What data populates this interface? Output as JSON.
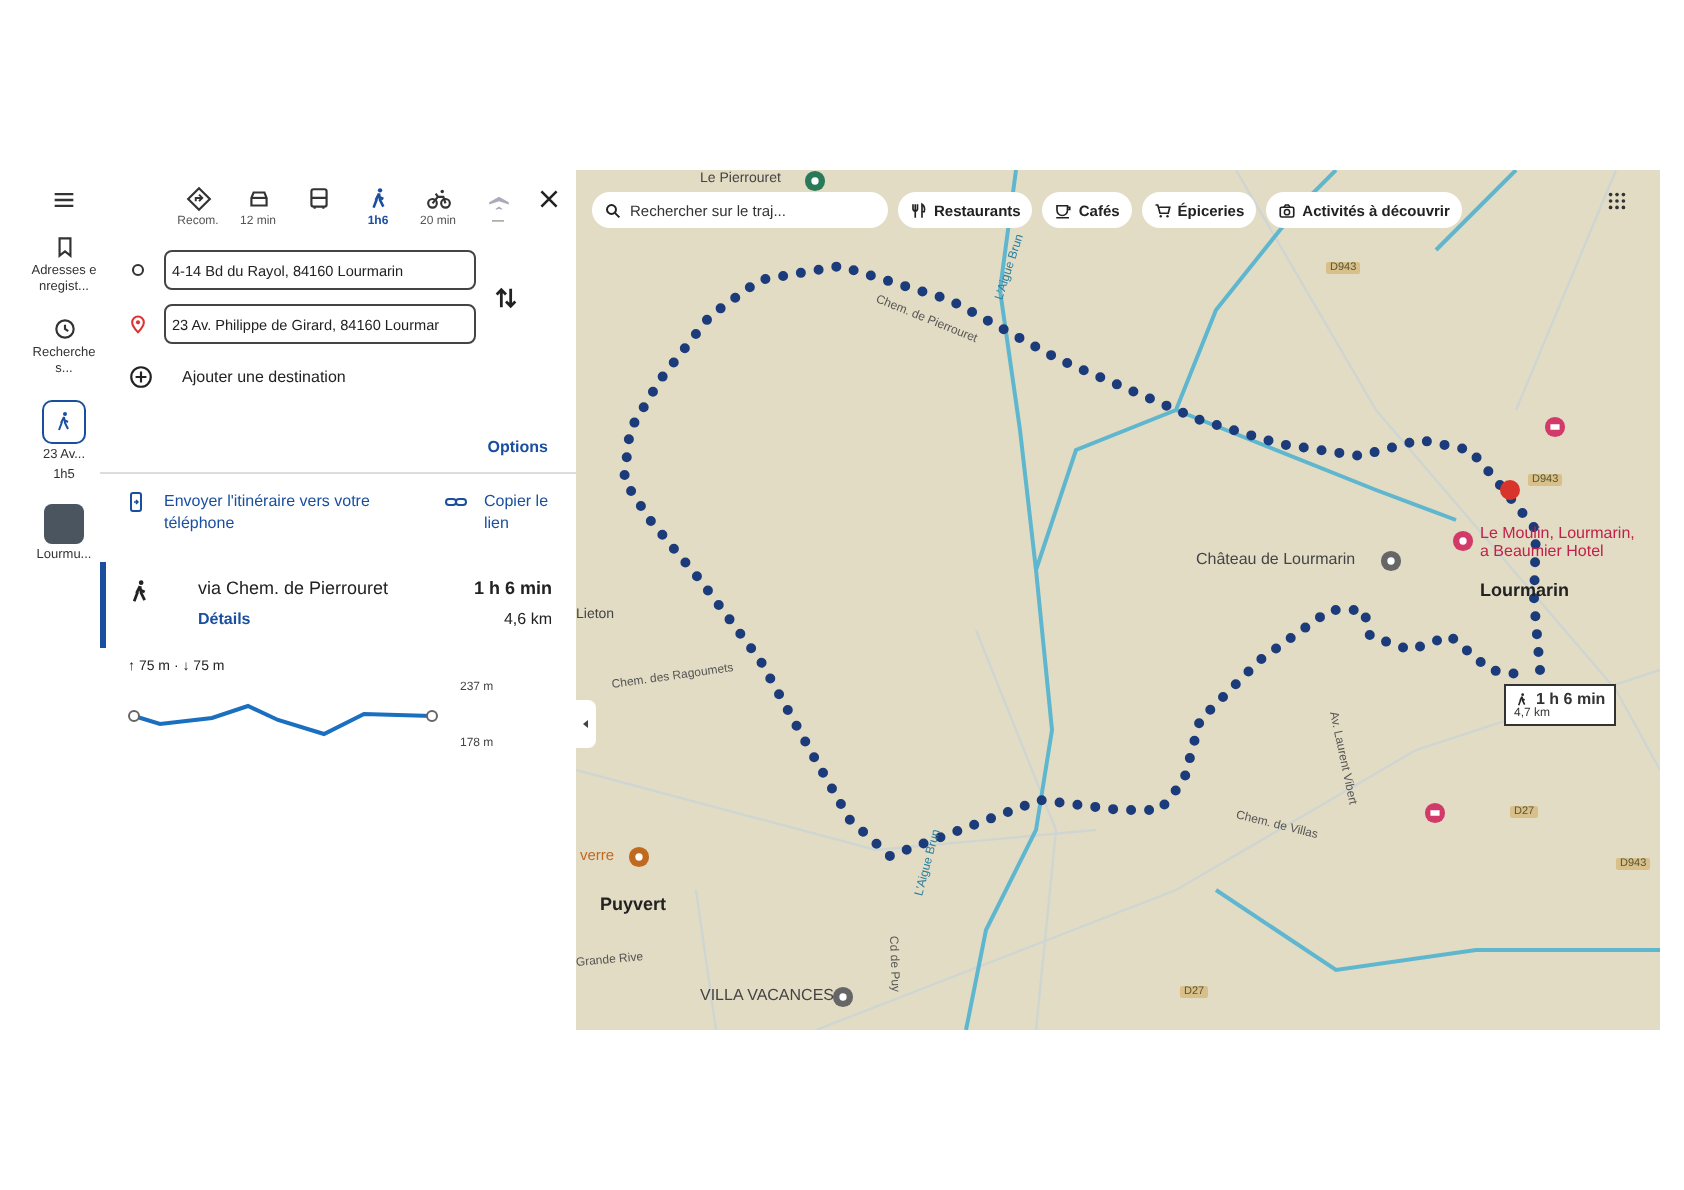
{
  "rail": {
    "items": [
      {
        "kind": "saved",
        "label": "Adresses enregist...",
        "selected": false
      },
      {
        "kind": "history",
        "label": "Recherches...",
        "selected": false
      },
      {
        "kind": "route",
        "label": "23 Av...",
        "sublabel": "1h5",
        "selected": true
      },
      {
        "kind": "thumbnail",
        "label": "Lourmu...",
        "selected": false
      }
    ]
  },
  "modes": [
    {
      "kind": "recommended",
      "label": "Recom.",
      "selected": false
    },
    {
      "kind": "car",
      "label": "12 min",
      "selected": false
    },
    {
      "kind": "transit",
      "selected": false
    },
    {
      "kind": "walk",
      "label": "1h6",
      "selected": true
    },
    {
      "kind": "bike",
      "label": "20 min",
      "selected": false
    },
    {
      "kind": "plane",
      "label": "—",
      "selected": false
    }
  ],
  "waypoints": [
    {
      "kind": "origin",
      "value": "4-14 Bd du Rayol, 84160 Lourmarin"
    },
    {
      "kind": "destination",
      "value": "23 Av. Philippe de Girard, 84160 Lourmar"
    }
  ],
  "add_destination": "Ajouter une destination",
  "options": "Options",
  "send_to_phone": "Envoyer l'itinéraire vers votre téléphone",
  "copy_link": "Copier le lien",
  "route": {
    "via": "via Chem. de Pierrouret",
    "duration": "1 h 6 min",
    "distance": "4,6 km",
    "details": "Détails",
    "selected": true
  },
  "elevation": {
    "summary": "↑ 75 m · ↓ 75 m",
    "max": "237 m",
    "min": "178 m"
  },
  "map": {
    "search_placeholder": "Rechercher sur le traj...",
    "chips": [
      {
        "kind": "restaurant",
        "label": "Restaurants"
      },
      {
        "kind": "cafe",
        "label": "Cafés"
      },
      {
        "kind": "grocery",
        "label": "Épiceries"
      },
      {
        "kind": "activity",
        "label": "Activités à découvrir"
      }
    ],
    "labels": [
      {
        "kind": "poi",
        "text": "Le Pierrouret"
      },
      {
        "kind": "shield",
        "text": "D943"
      },
      {
        "kind": "river",
        "text": "L'Aigue Brun"
      },
      {
        "kind": "road",
        "text": "Chem. de Pierrouret"
      },
      {
        "kind": "shield",
        "text": "D943"
      },
      {
        "kind": "hotel",
        "text": "Le Moulin, Lourmarin, a Beaumier Hotel"
      },
      {
        "kind": "town",
        "text": "Lourmarin"
      },
      {
        "kind": "landmark",
        "text": "Château de Lourmarin"
      },
      {
        "kind": "place",
        "text": "Lieton"
      },
      {
        "kind": "road",
        "text": "Chem. des Ragoumets"
      },
      {
        "kind": "road",
        "text": "Av. Laurent Vibert"
      },
      {
        "kind": "road",
        "text": "Chem. de Villas"
      },
      {
        "kind": "shield",
        "text": "D27"
      },
      {
        "kind": "shield",
        "text": "D943"
      },
      {
        "kind": "restaurant",
        "text": "verre"
      },
      {
        "kind": "town",
        "text": "Puyvert"
      },
      {
        "kind": "road",
        "text": "Grande Rive"
      },
      {
        "kind": "river",
        "text": "L'Aigue Brun"
      },
      {
        "kind": "road",
        "text": "Cd de Puy"
      },
      {
        "kind": "landmark",
        "text": "VILLA VACANCES"
      },
      {
        "kind": "shield",
        "text": "D27"
      }
    ],
    "route_tooltip": {
      "duration": "1 h 6 min",
      "distance": "4,7 km"
    }
  }
}
